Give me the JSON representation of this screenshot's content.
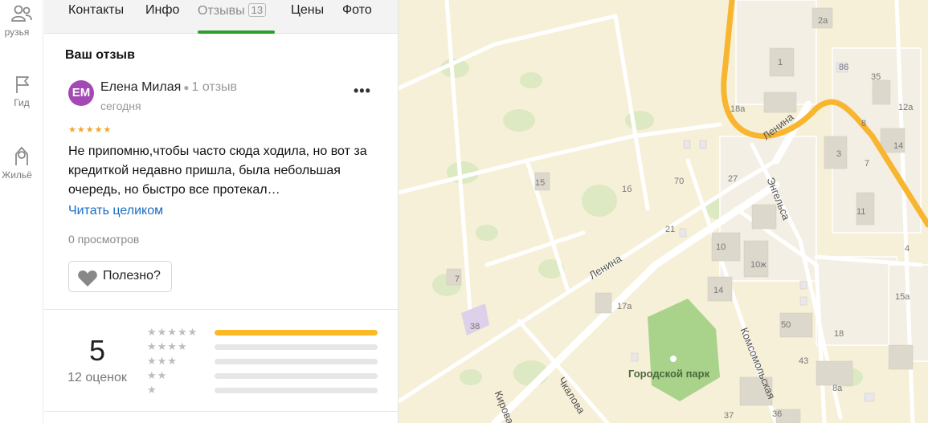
{
  "rail": {
    "friends": "рузья",
    "guide": "Гид",
    "housing": "Жильё"
  },
  "tabs": {
    "contacts": "Контакты",
    "info": "Инфо",
    "reviews": "Отзывы",
    "reviews_count": "13",
    "prices": "Цены",
    "photos": "Фото"
  },
  "review": {
    "section_title": "Ваш отзыв",
    "avatar_initials": "ЕМ",
    "author": "Елена Милая",
    "author_reviews": "1 отзыв",
    "date": "сегодня",
    "rating": 5,
    "text": "Не припомню,чтобы часто сюда ходила, но вот за кредиткой недавно пришла, была небольшая очередь, но быстро все протекал…",
    "read_more": "Читать целиком",
    "views": "0 просмотров",
    "useful_label": "Полезно?"
  },
  "summary": {
    "score": "5",
    "ratings_count": "12 оценок",
    "distribution": [
      {
        "stars": 5,
        "fraction": 1.0
      },
      {
        "stars": 4,
        "fraction": 0.0
      },
      {
        "stars": 3,
        "fraction": 0.0
      },
      {
        "stars": 2,
        "fraction": 0.0
      },
      {
        "stars": 1,
        "fraction": 0.0
      }
    ]
  },
  "map": {
    "streets": {
      "lenina_1": "Ленина",
      "lenina_2": "Ленина",
      "engelsa": "Энгельса",
      "komsomolskaya": "Комсомольская",
      "chkalova": "Чкалова",
      "kirova": "Кирова"
    },
    "park": "Городской парк",
    "house_numbers": [
      "2а",
      "1",
      "86",
      "35",
      "18а",
      "12а",
      "8",
      "14",
      "3",
      "7",
      "70",
      "27",
      "15",
      "1б",
      "11",
      "21",
      "10",
      "10ж",
      "4",
      "7",
      "14",
      "17а",
      "15а",
      "38",
      "50",
      "18",
      "43",
      "8а",
      "36",
      "37"
    ]
  }
}
